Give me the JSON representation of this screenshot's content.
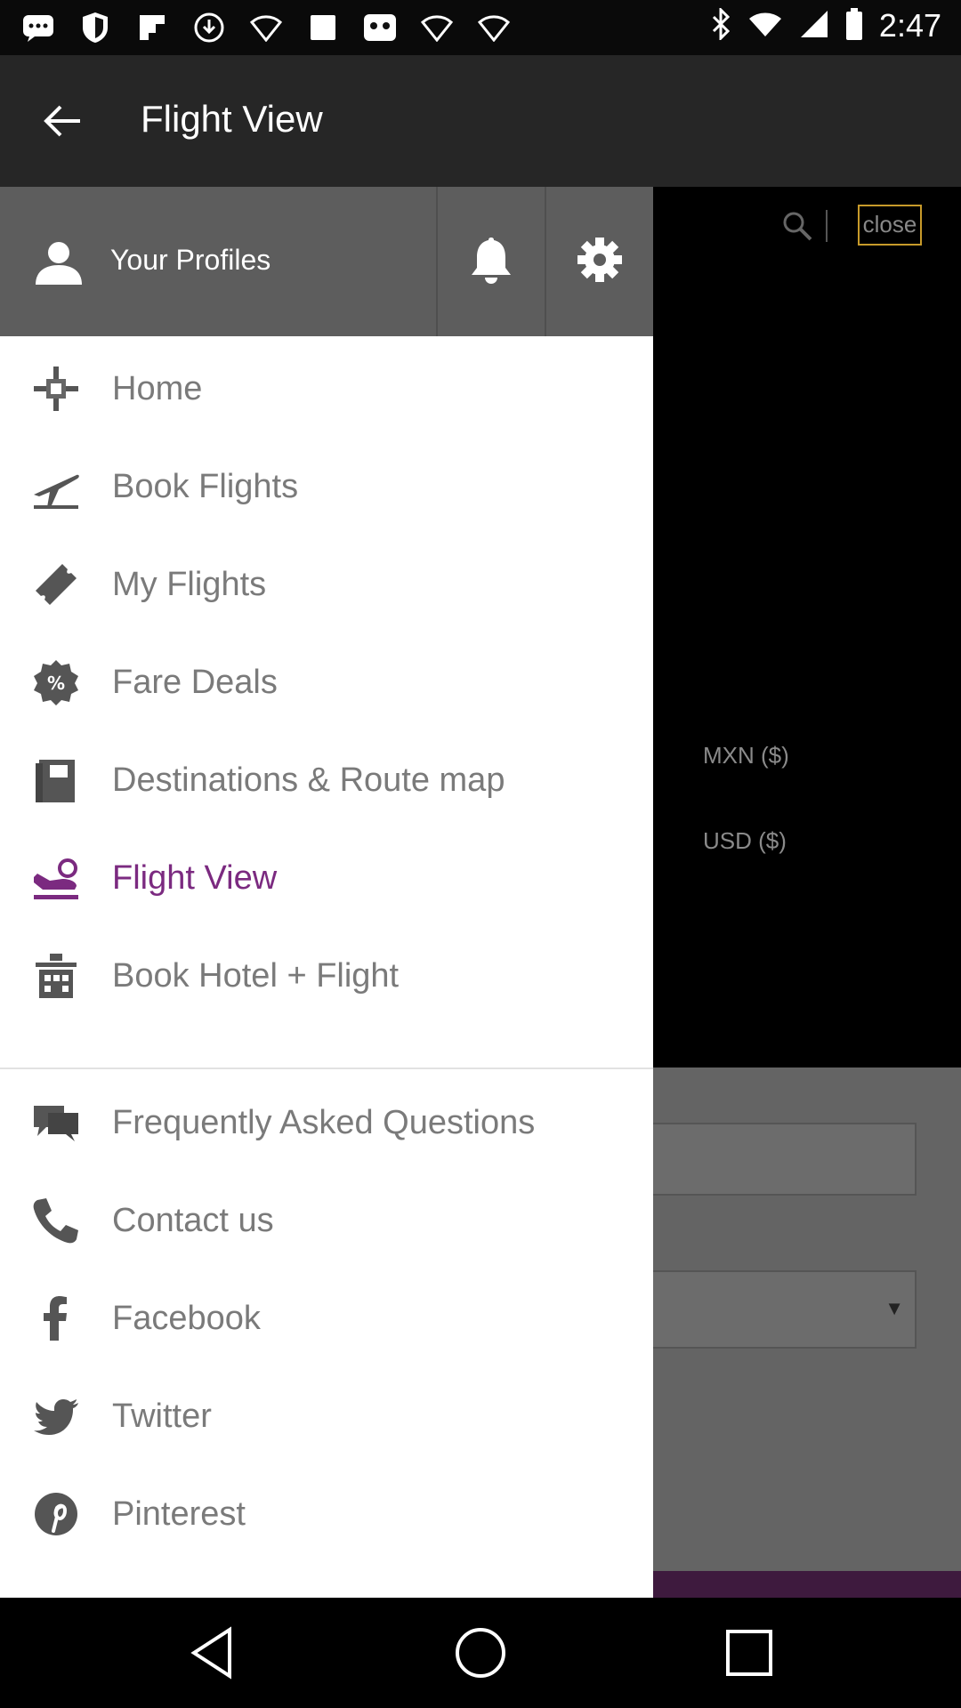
{
  "status_bar": {
    "time": "2:47",
    "icons": [
      "messages-icon",
      "shield-icon",
      "flipboard-icon",
      "download-icon",
      "wifi-icon",
      "square-icon",
      "gallery-icon",
      "square-icon",
      "wifi-icon",
      "wifi-icon",
      "bluetooth-icon",
      "wifi-signal-icon",
      "cell-signal-icon",
      "battery-icon"
    ]
  },
  "app_bar": {
    "title": "Flight View"
  },
  "background": {
    "close_label": "close",
    "currency_1": "MXN ($)",
    "currency_2": "USD ($)"
  },
  "drawer": {
    "profile_label": "Your Profiles",
    "items": [
      {
        "label": "Home",
        "icon": "home-icon"
      },
      {
        "label": "Book Flights",
        "icon": "airplane-icon"
      },
      {
        "label": "My Flights",
        "icon": "ticket-icon"
      },
      {
        "label": "Fare Deals",
        "icon": "percent-badge-icon"
      },
      {
        "label": "Destinations & Route map",
        "icon": "map-book-icon"
      },
      {
        "label": "Flight View",
        "icon": "landing-icon",
        "active": true
      },
      {
        "label": "Book Hotel + Flight",
        "icon": "hotel-icon"
      }
    ],
    "secondary_items": [
      {
        "label": "Frequently Asked Questions",
        "icon": "chat-icon"
      },
      {
        "label": "Contact us",
        "icon": "phone-icon"
      },
      {
        "label": "Facebook",
        "icon": "facebook-icon"
      },
      {
        "label": "Twitter",
        "icon": "twitter-icon"
      },
      {
        "label": "Pinterest",
        "icon": "pinterest-icon"
      }
    ]
  },
  "colors": {
    "accent": "#7b2a80",
    "drawer_header": "#5d5d5d",
    "app_bar": "#262626"
  }
}
